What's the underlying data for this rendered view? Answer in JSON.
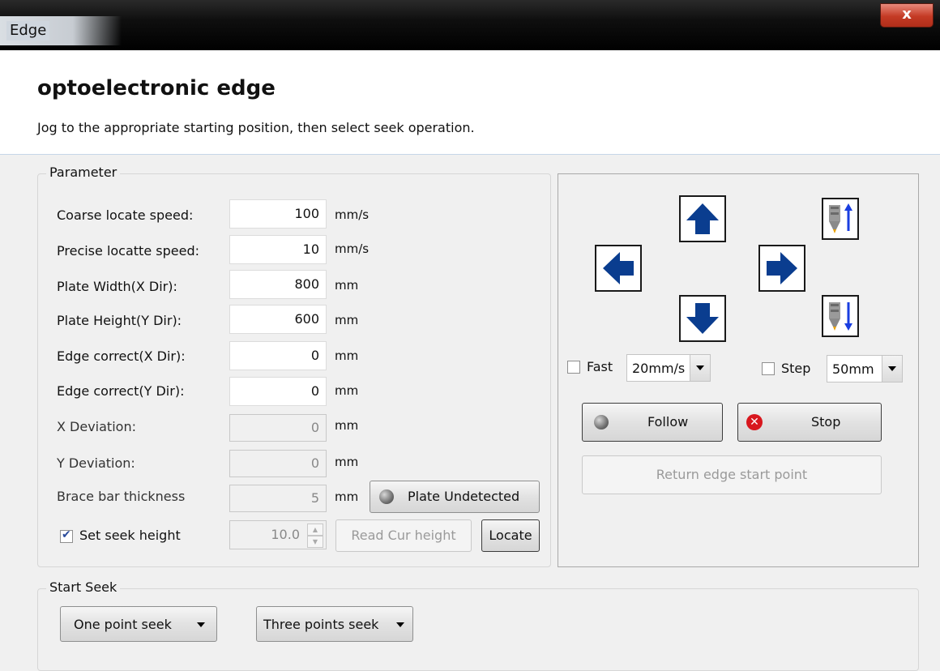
{
  "window": {
    "title": "Edge",
    "close_label": "x"
  },
  "header": {
    "title": "optoelectronic edge",
    "subtitle": "Jog to the appropriate starting position, then select seek operation."
  },
  "parameter": {
    "legend": "Parameter",
    "rows": [
      {
        "label": "Coarse locate speed:",
        "value": "100",
        "unit": "mm/s"
      },
      {
        "label": "Precise locatte speed:",
        "value": "10",
        "unit": "mm/s"
      },
      {
        "label": "Plate Width(X Dir):",
        "value": "800",
        "unit": "mm"
      },
      {
        "label": "Plate  Height(Y Dir):",
        "value": "600",
        "unit": "mm"
      },
      {
        "label": "Edge correct(X Dir):",
        "value": "0",
        "unit": "mm"
      },
      {
        "label": "Edge correct(Y Dir):",
        "value": "0",
        "unit": "mm"
      },
      {
        "label": "X Deviation:",
        "value": "0",
        "unit": "mm"
      },
      {
        "label": "Y Deviation:",
        "value": "0",
        "unit": "mm"
      },
      {
        "label": "Brace bar thickness",
        "value": "5",
        "unit": "mm"
      }
    ],
    "plate_status": "Plate Undetected",
    "seek_height_label": "Set seek height",
    "seek_height_checked": true,
    "seek_height_value": "10.0",
    "read_cur_height_label": "Read Cur height",
    "locate_label": "Locate"
  },
  "jog": {
    "fast_label": "Fast",
    "fast_speed": "20mm/s",
    "step_label": "Step",
    "step_value": "50mm",
    "follow_label": "Follow",
    "stop_label": "Stop",
    "return_label": "Return edge start point",
    "arrow_color": "#0a3d8f"
  },
  "start_seek": {
    "legend": "Start Seek",
    "one_point": "One point seek",
    "three_points": "Three points seek"
  }
}
